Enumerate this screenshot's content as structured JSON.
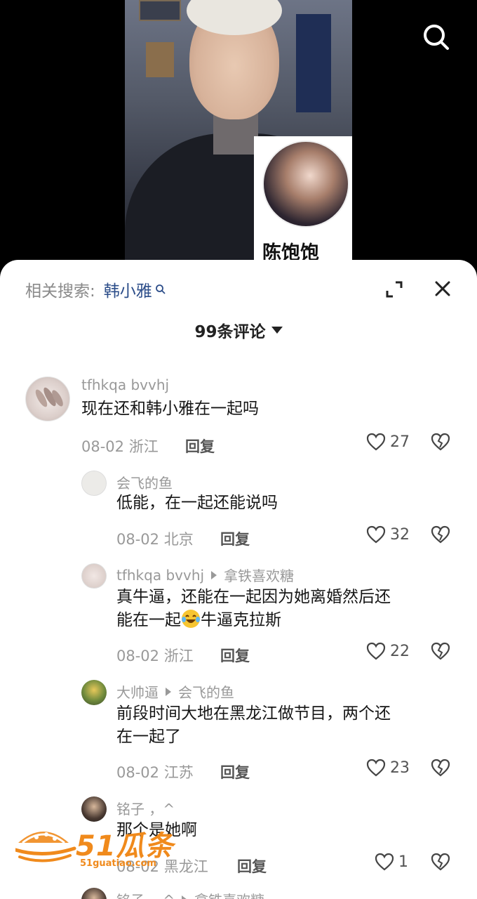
{
  "video": {
    "pip_name": "陈饱饱"
  },
  "related": {
    "label": "相关搜索:",
    "term": "韩小雅"
  },
  "comment_count": "99条评论",
  "comments": [
    {
      "user": "tfhkqa bvvhj",
      "text": "现在还和韩小雅在一起吗",
      "date": "08-02",
      "location": "浙江",
      "reply": "回复",
      "likes": "27"
    },
    {
      "user": "会飞的鱼",
      "text": "低能，在一起还能说吗",
      "date": "08-02",
      "location": "北京",
      "reply": "回复",
      "likes": "32"
    },
    {
      "user": "tfhkqa bvvhj",
      "reply_to": "拿铁喜欢糖",
      "text_line1": "真牛逼，还能在一起因为她离婚然后还",
      "text_line2_a": "能在一起",
      "text_line2_b": "牛逼克拉斯",
      "date": "08-02",
      "location": "浙江",
      "reply": "回复",
      "likes": "22"
    },
    {
      "user": "大帅逼",
      "reply_to": "会飞的鱼",
      "text_line1": "前段时间大地在黑龙江做节目，两个还",
      "text_line2": "在一起了",
      "date": "08-02",
      "location": "江苏",
      "reply": "回复",
      "likes": "23"
    },
    {
      "user": "铭子 ，^",
      "text": "那个是她啊",
      "date": "08-02",
      "location": "黑龙江",
      "reply": "回复",
      "likes": "1"
    },
    {
      "user": "铭子 ，^",
      "reply_to": "拿铁喜欢糖"
    }
  ],
  "watermark": {
    "brand": "51瓜条",
    "site": "51guatiao.com"
  },
  "colors": {
    "accent_link": "#2d4e8a",
    "meta_gray": "#999999",
    "watermark_orange": "#f08a1c"
  }
}
